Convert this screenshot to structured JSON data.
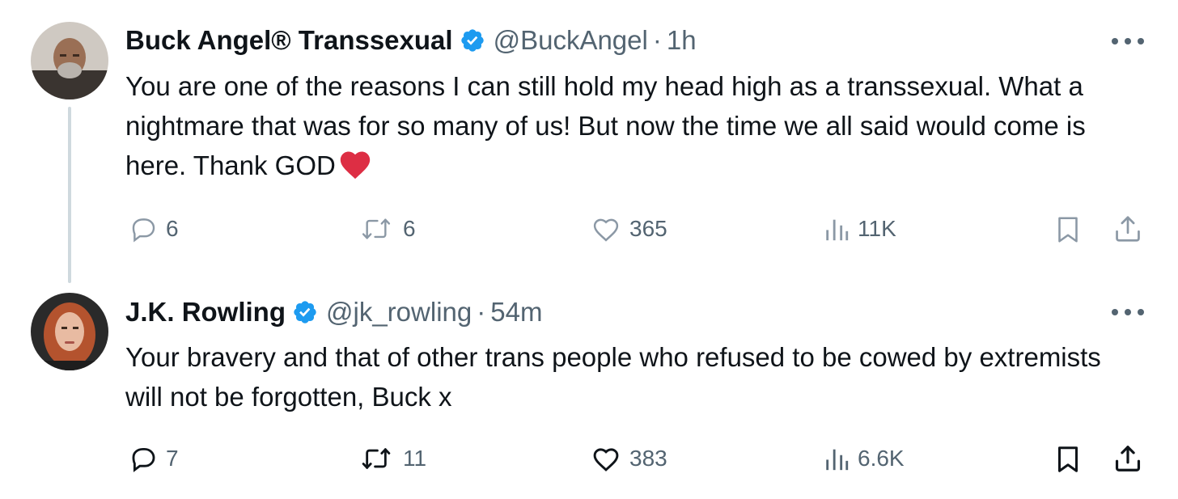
{
  "tweets": [
    {
      "author": {
        "name": "Buck Angel® Transsexual",
        "handle": "@BuckAngel",
        "time": "1h",
        "verified": true,
        "avatar_icon": "bald-man-avatar"
      },
      "text": "You are one of the reasons I can still hold my head high as a transsexual. What a nightmare that was for so many of us! But now the time we all said would come is here. Thank GOD",
      "emoji": "red-heart",
      "stats": {
        "replies": "6",
        "reposts": "6",
        "likes": "365",
        "views": "11K"
      },
      "has_thread_line": true
    },
    {
      "author": {
        "name": "J.K. Rowling",
        "handle": "@jk_rowling",
        "time": "54m",
        "verified": true,
        "avatar_icon": "woman-avatar"
      },
      "text": "Your bravery and that of other trans people who refused to be cowed by extremists will not be forgotten, Buck x",
      "stats": {
        "replies": "7",
        "reposts": "11",
        "likes": "383",
        "views": "6.6K"
      },
      "has_thread_line": false
    }
  ],
  "separator": "·",
  "colors": {
    "text": "#0f1419",
    "secondary": "#536471",
    "verified": "#1d9bf0",
    "thread_line": "#cfd9de",
    "heart_emoji": "#dd2e44"
  }
}
